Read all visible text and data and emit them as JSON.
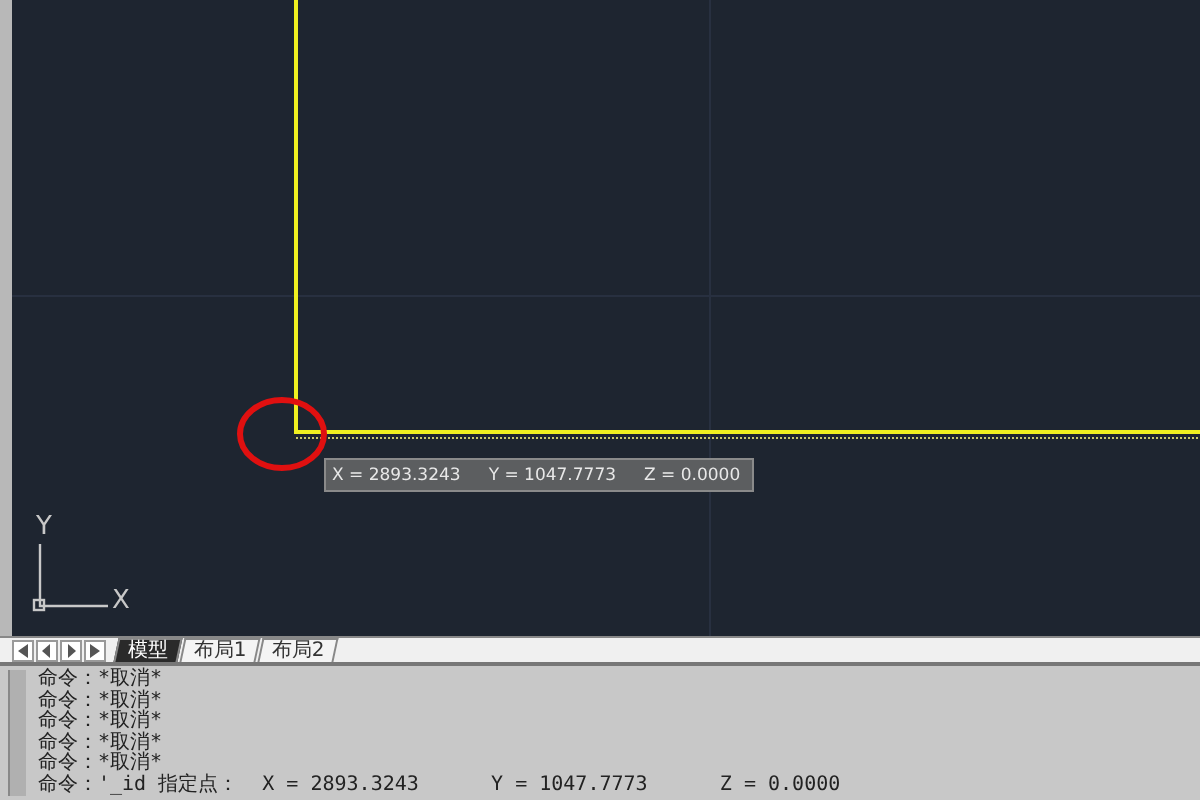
{
  "canvas": {
    "ucs_labels": {
      "y": "Y",
      "x": "X"
    },
    "coordinate_tooltip": [
      "X = 2893.3243",
      "Y = 1047.7773",
      "Z = 0.0000"
    ],
    "highlight_circle": true
  },
  "layout_tabs": [
    {
      "label": "模型",
      "selected": true
    },
    {
      "label": "布局1",
      "selected": false
    },
    {
      "label": "布局2",
      "selected": false
    }
  ],
  "command_history": [
    "命令：*取消*",
    "命令：*取消*",
    "命令：*取消*",
    "命令：*取消*",
    "命令：*取消*",
    "命令：'_id 指定点：  X = 2893.3243      Y = 1047.7773      Z = 0.0000"
  ]
}
